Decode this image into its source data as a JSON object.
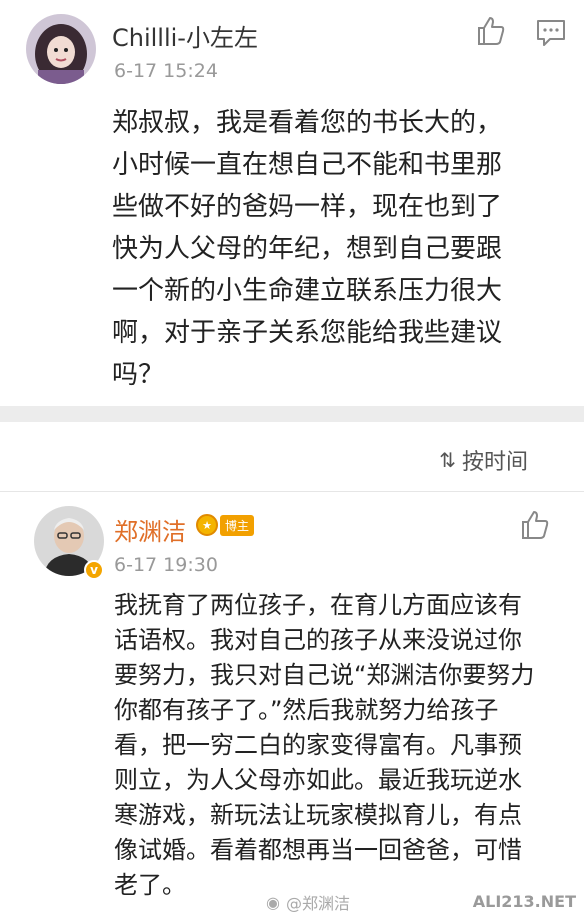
{
  "comment1": {
    "username": "Chillli-小左左",
    "timestamp": "6-17 15:24",
    "lines": [
      "郑叔叔，我是看着您的书长大的，",
      "小时候一直在想自己不能和书里那",
      "些做不好的爸妈一样，现在也到了",
      "快为人父母的年纪，想到自己要跟",
      "一个新的小生命建立联系压力很大",
      "啊，对于亲子关系您能给我些建议",
      "吗？"
    ]
  },
  "sort_bar": {
    "label": "按时间",
    "icon": "sort-icon"
  },
  "comment2": {
    "username": "郑渊洁",
    "badge": "博主",
    "verified_mark": "v",
    "timestamp": "6-17 19:30",
    "lines": [
      "我抚育了两位孩子，在育儿方面应该有",
      "话语权。我对自己的孩子从来没说过你",
      "要努力，我只对自己说“郑渊洁你要努力",
      "你都有孩子了。”然后我就努力给孩子",
      "看，把一穷二白的家变得富有。凡事预",
      "则立，为人父母亦如此。最近我玩逆水",
      "寒游戏，新玩法让玩家模拟育儿，有点",
      "像试婚。看着都想再当一回爸爸，可惜",
      "老了。"
    ]
  },
  "watermark": {
    "text": "@郑渊洁"
  },
  "site_mark": {
    "text": "ALI213.NET"
  },
  "colors": {
    "badge": "#f2a000",
    "separator": "#ececec",
    "timestamp": "#999999"
  }
}
